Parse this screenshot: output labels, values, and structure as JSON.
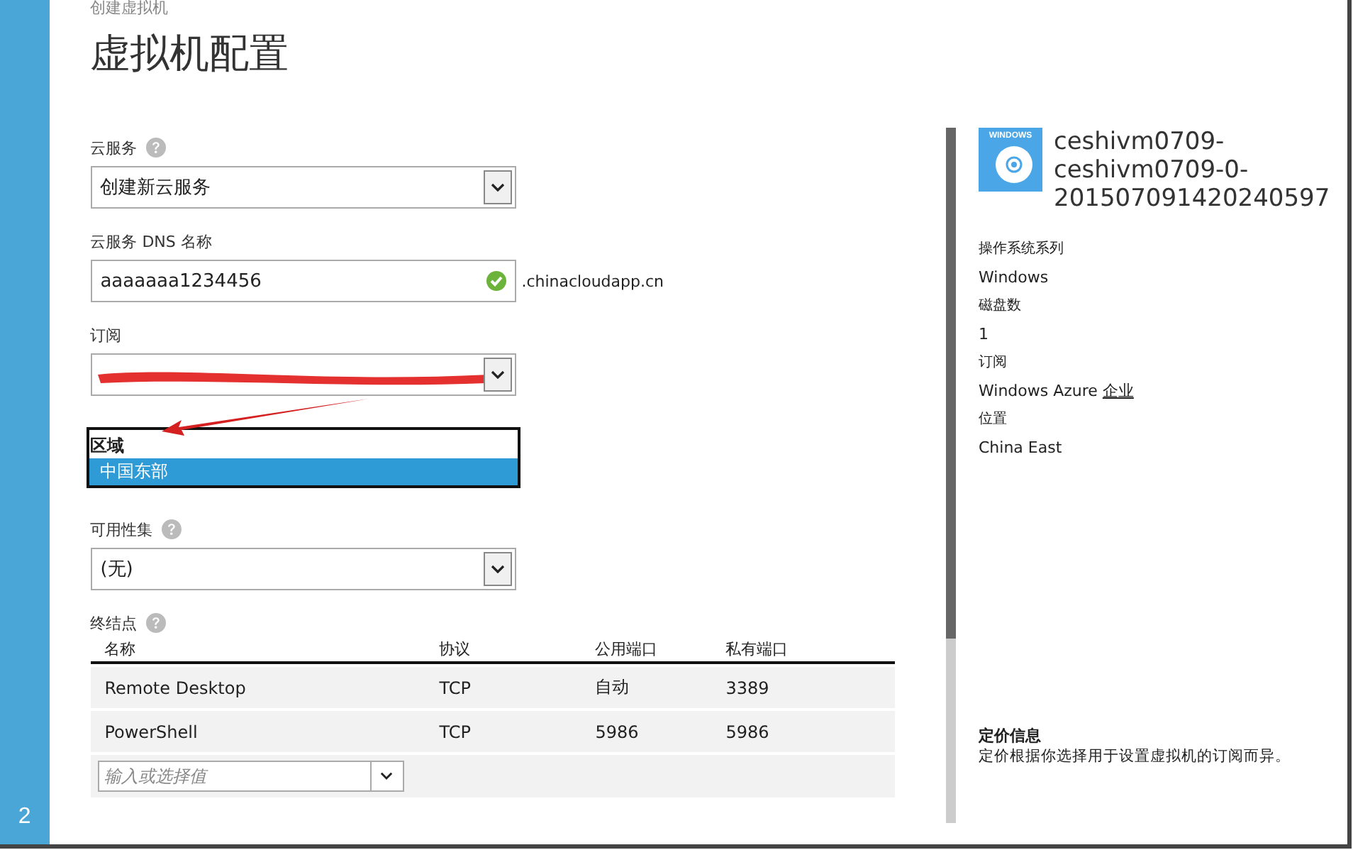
{
  "step": "2",
  "breadcrumb": "创建虚拟机",
  "title": "虚拟机配置",
  "fields": [
    {
      "kind": "select",
      "label": "云服务",
      "help": true,
      "value": "创建新云服务"
    },
    {
      "kind": "text",
      "label": "云服务 DNS 名称",
      "help": false,
      "value": "aaaaaaa1234456",
      "valid": true,
      "suffix": ".chinacloudapp.cn"
    },
    {
      "kind": "redacted",
      "label": "订阅",
      "help": false
    },
    {
      "kind": "list",
      "label": "区域",
      "help": false,
      "options": [
        {
          "label": "中国东部",
          "selected": true
        }
      ]
    },
    {
      "kind": "select",
      "label": "可用性集",
      "help": true,
      "value": "(无)"
    }
  ],
  "endpoints": {
    "label": "终结点",
    "help": true,
    "columns": [
      "名称",
      "协议",
      "公用端口",
      "私有端口"
    ],
    "rows": [
      [
        "Remote Desktop",
        "TCP",
        "自动",
        "3389"
      ],
      [
        "PowerShell",
        "TCP",
        "5986",
        "5986"
      ]
    ],
    "new_endpoint": {
      "placeholder": "输入或选择值"
    }
  },
  "summary": {
    "icon_label": "WINDOWS",
    "title": "ceshivm0709-ceshivm0709-0-201507091420240597",
    "properties": [
      {
        "label": "操作系统系列",
        "value": "Windows"
      },
      {
        "label": "磁盘数",
        "value": "1"
      },
      {
        "label": "订阅",
        "value": "Windows Azure",
        "link": "企业"
      },
      {
        "label": "位置",
        "value": "China East"
      }
    ],
    "pricing": {
      "title": "定价信息",
      "text": "定价根据你选择用于设置虚拟机的订阅而异。"
    }
  }
}
